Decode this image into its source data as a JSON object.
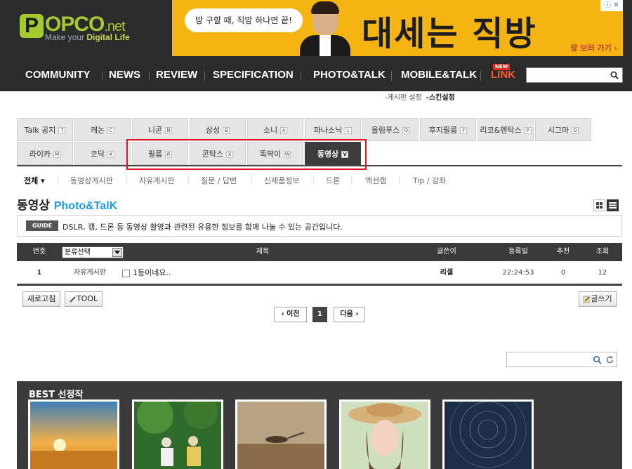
{
  "logo": {
    "letter": "P",
    "name": "OPCO",
    "suffix": ".net",
    "tagline_pre": "Make your ",
    "tagline_bold": "Digital Life"
  },
  "ad": {
    "bubble": "방 구할 때, 직방 하나면 끝!",
    "headline": "대세는 직방",
    "cta": "방 보러 가기 ›",
    "corner": "ⓘ ✕"
  },
  "topnav": {
    "items": [
      "COMMUNITY",
      "NEWS",
      "REVIEW",
      "SPECIFICATION",
      "PHOTO&TALK",
      "MOBILE&TALK",
      "LINK"
    ],
    "new_badge": "NEW",
    "search_placeholder": ""
  },
  "sublinks": [
    "-게시판 설정",
    "-스킨설정"
  ],
  "tabs": [
    {
      "label": "Talk 공지",
      "key": "T"
    },
    {
      "label": "캐논",
      "key": "C"
    },
    {
      "label": "니콘",
      "key": "N"
    },
    {
      "label": "삼성",
      "key": "B"
    },
    {
      "label": "소니",
      "key": "A"
    },
    {
      "label": "파나소닉",
      "key": "L"
    },
    {
      "label": "올림푸스",
      "key": "O"
    },
    {
      "label": "후지필름",
      "key": "F"
    },
    {
      "label": "리코&펜탁스",
      "key": "P"
    },
    {
      "label": "시그마",
      "key": "D"
    },
    {
      "label": "라이카",
      "key": "M"
    },
    {
      "label": "코닥",
      "key": "K"
    },
    {
      "label": "필름",
      "key": "R"
    },
    {
      "label": "콘탁스",
      "key": "X"
    },
    {
      "label": "똑딱이",
      "key": "W"
    },
    {
      "label": "동영상",
      "key": "V",
      "active": true
    }
  ],
  "categories": [
    "전체 ▾",
    "동영상게시판",
    "자유게시판",
    "질문 / 답변",
    "신제품정보",
    "드론",
    "액션캠",
    "Tip / 강좌"
  ],
  "board": {
    "title": "동영상",
    "title_en": "Photo&TalK",
    "guide_badge": "GUIDE",
    "guide_text": "DSLR, 캠, 드론 등 동영상 촬영과 관련된 유용한 정보를 함께 나눌 수 있는 공간입니다."
  },
  "table": {
    "headers": {
      "no": "번호",
      "category": "분류선택",
      "subject": "제목",
      "author": "글쓴이",
      "date": "등록일",
      "recommend": "추천",
      "views": "조회"
    },
    "rows": [
      {
        "no": "1",
        "category": "자유게시판",
        "subject": "1등이네요..",
        "author": "리셀",
        "date": "22:24:53",
        "recommend": "0",
        "views": "12"
      }
    ]
  },
  "buttons": {
    "refresh": "새로고침",
    "tool": "TOOL",
    "write": "글쓰기"
  },
  "pagination": {
    "prev": "‹ 이전",
    "current": "1",
    "next": "다음 ›"
  },
  "bottom_search": {
    "placeholder": ""
  },
  "best": {
    "title": "BEST 선정작"
  },
  "colors": {
    "header_bg": "#2b2b2b",
    "accent_green": "#a6c930",
    "accent_blue": "#1e9be0",
    "ad_yellow": "#f4b411",
    "highlight_red": "#e0141e"
  }
}
